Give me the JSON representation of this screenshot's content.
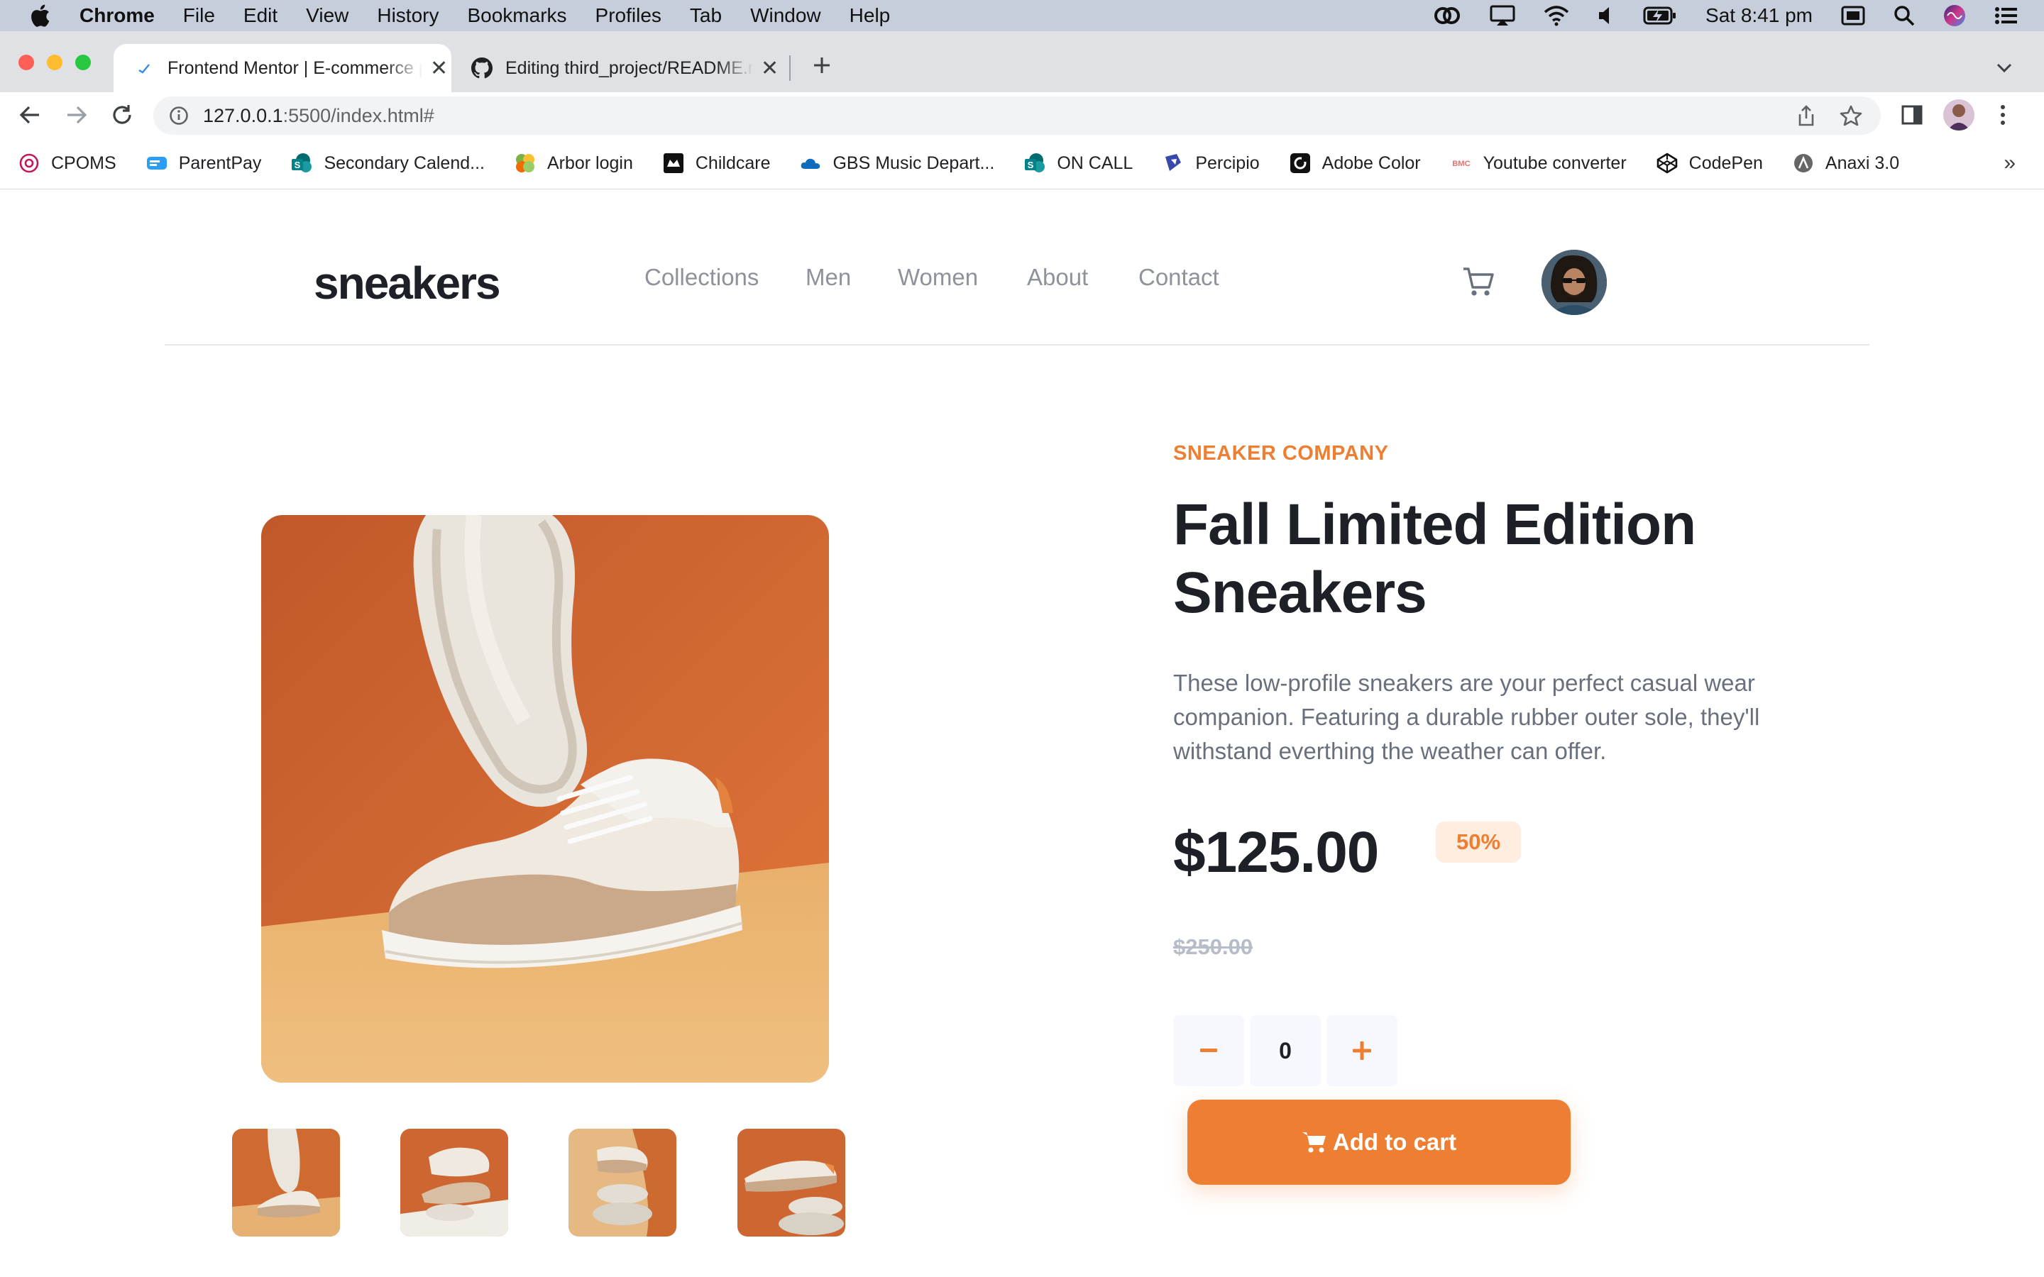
{
  "menubar": {
    "app_name": "Chrome",
    "items": [
      "File",
      "Edit",
      "View",
      "History",
      "Bookmarks",
      "Profiles",
      "Tab",
      "Window",
      "Help"
    ],
    "clock": "Sat 8:41 pm"
  },
  "tabs": [
    {
      "title": "Frontend Mentor | E-commerce product page",
      "active": true
    },
    {
      "title": "Editing third_project/README.md",
      "active": false
    }
  ],
  "toolbar": {
    "url_host": "127.0.0.1",
    "url_path": ":5500/index.html#"
  },
  "bookmarks": [
    {
      "label": "CPOMS",
      "icon": "cpoms-icon",
      "color": "#c2185b"
    },
    {
      "label": "ParentPay",
      "icon": "parentpay-icon",
      "color": "#2a9df4"
    },
    {
      "label": "Secondary Calend...",
      "icon": "sharepoint-icon",
      "color": "#038387"
    },
    {
      "label": "Arbor login",
      "icon": "arbor-icon",
      "color": "#7cb342"
    },
    {
      "label": "Childcare",
      "icon": "childcare-icon",
      "color": "#111111"
    },
    {
      "label": "GBS Music Depart...",
      "icon": "onedrive-icon",
      "color": "#0f6cbd"
    },
    {
      "label": "ON CALL",
      "icon": "sharepoint-icon",
      "color": "#038387"
    },
    {
      "label": "Percipio",
      "icon": "percipio-icon",
      "color": "#3949ab"
    },
    {
      "label": "Adobe Color",
      "icon": "adobe-color-icon",
      "color": "#111111"
    },
    {
      "label": "Youtube converter",
      "icon": "bmc-icon",
      "color": "#e57373"
    },
    {
      "label": "CodePen",
      "icon": "codepen-icon",
      "color": "#111111"
    },
    {
      "label": "Anaxi 3.0",
      "icon": "anaxi-icon",
      "color": "#666666"
    }
  ],
  "site": {
    "brand": "sneakers",
    "nav": [
      "Collections",
      "Men",
      "Women",
      "About",
      "Contact"
    ]
  },
  "product": {
    "company": "SNEAKER COMPANY",
    "title": "Fall Limited Edition Sneakers",
    "description": "These low-profile sneakers are your perfect casual wear companion. Featuring a durable rubber outer sole, they'll withstand everthing the weather can offer.",
    "price": "$125.00",
    "discount": "50%",
    "old_price": "$250.00",
    "quantity": "0",
    "minus": "–",
    "plus": "+",
    "add_to_cart": "Add to cart"
  },
  "colors": {
    "accent": "#ee7f32",
    "accent_pale": "#ffede0",
    "dark": "#1d2026",
    "muted": "#69707d"
  }
}
